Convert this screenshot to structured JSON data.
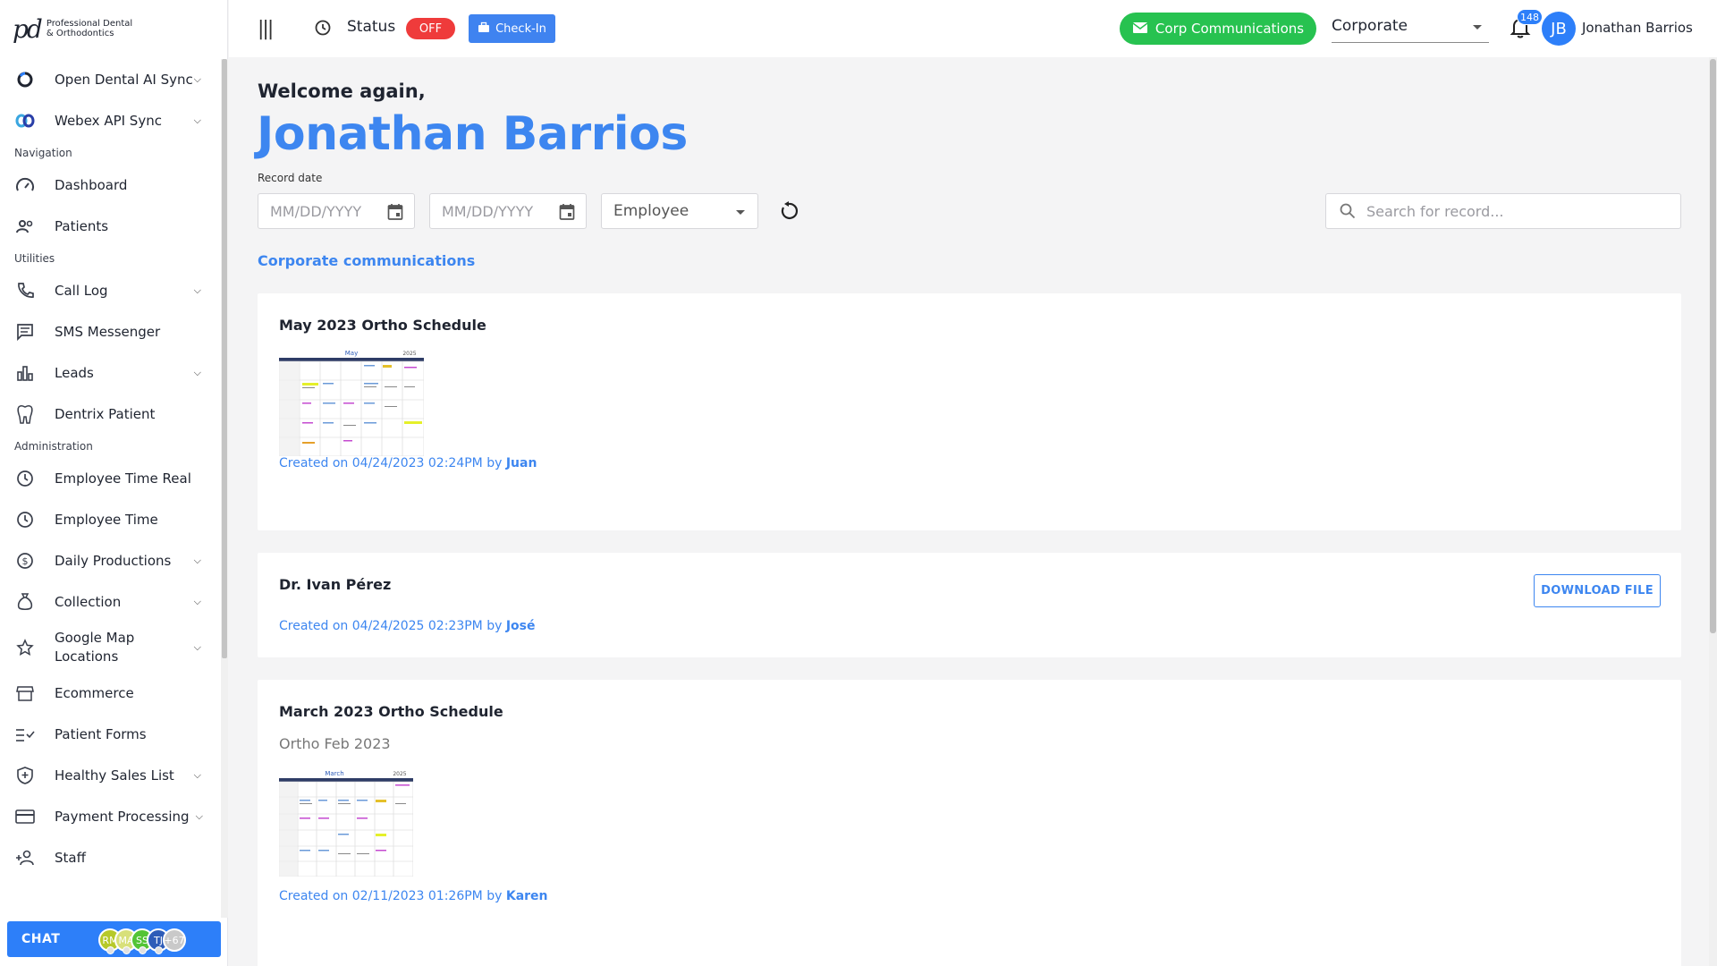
{
  "brand": {
    "name_line1": "Professional Dental",
    "name_line2": "& Orthodontics",
    "mark": "pd"
  },
  "sidebar": {
    "top_items": [
      {
        "label": "Open Dental AI Sync",
        "icon": "circle-icon",
        "expandable": true
      },
      {
        "label": "Webex API Sync",
        "icon": "webex-icon",
        "expandable": true
      }
    ],
    "sections": [
      {
        "title": "Navigation",
        "items": [
          {
            "label": "Dashboard",
            "icon": "gauge-icon",
            "expandable": false
          },
          {
            "label": "Patients",
            "icon": "users-icon",
            "expandable": false
          }
        ]
      },
      {
        "title": "Utilities",
        "items": [
          {
            "label": "Call Log",
            "icon": "phone-icon",
            "expandable": true
          },
          {
            "label": "SMS Messenger",
            "icon": "message-icon",
            "expandable": false
          },
          {
            "label": "Leads",
            "icon": "bar-chart-icon",
            "expandable": true
          },
          {
            "label": "Dentrix Patient",
            "icon": "tooth-icon",
            "expandable": false
          }
        ]
      },
      {
        "title": "Administration",
        "items": [
          {
            "label": "Employee Time Real",
            "icon": "clock-icon",
            "expandable": false
          },
          {
            "label": "Employee Time",
            "icon": "clock-icon",
            "expandable": false
          },
          {
            "label": "Daily Productions",
            "icon": "dollar-icon",
            "expandable": true
          },
          {
            "label": "Collection",
            "icon": "money-bag-icon",
            "expandable": true
          },
          {
            "label": "Google Map Locations",
            "icon": "star-icon",
            "expandable": true
          },
          {
            "label": "Ecommerce",
            "icon": "store-icon",
            "expandable": false
          },
          {
            "label": "Patient Forms",
            "icon": "checklist-icon",
            "expandable": false
          },
          {
            "label": "Healthy Sales List",
            "icon": "shield-icon",
            "expandable": true
          },
          {
            "label": "Payment Processing",
            "icon": "card-icon",
            "expandable": true
          },
          {
            "label": "Staff",
            "icon": "add-person-icon",
            "expandable": false
          }
        ]
      }
    ],
    "chat": {
      "label": "CHAT",
      "avatars": [
        {
          "initials": "RM",
          "color": "#b6c92a"
        },
        {
          "initials": "MA",
          "color": "#d8e07a"
        },
        {
          "initials": "SS",
          "color": "#53c435"
        },
        {
          "initials": "TJ",
          "color": "#2e5cb8"
        },
        {
          "initials": "+67",
          "color": "#c9c9c9"
        }
      ]
    }
  },
  "header": {
    "status_label": "Status",
    "status_value": "OFF",
    "checkin_label": "Check-In",
    "corp_button_label": "Corp Communications",
    "company_select": "Corporate",
    "notifications_count": "148",
    "user_initials": "JB",
    "user_name": "Jonathan Barrios"
  },
  "main": {
    "welcome": "Welcome again,",
    "user_name": "Jonathan Barrios",
    "filters": {
      "record_date_label": "Record date",
      "date_from_placeholder": "MM/DD/YYYY",
      "date_to_placeholder": "MM/DD/YYYY",
      "employee_select": "Employee",
      "search_placeholder": "Search for record..."
    },
    "section_title": "Corporate communications",
    "cards": [
      {
        "title": "May 2023 Ortho Schedule",
        "subtitle": "",
        "thumb_month": "May",
        "thumb_year": "2025",
        "created_prefix": "Created on ",
        "created_date": "04/24/2023 02:24PM",
        "by": " by ",
        "author": "Juan"
      },
      {
        "title": "Dr. Ivan Pérez",
        "subtitle": "",
        "download_label": "DOWNLOAD FILE",
        "created_prefix": "Created on ",
        "created_date": "04/24/2025 02:23PM",
        "by": " by ",
        "author": "José"
      },
      {
        "title": "March 2023 Ortho Schedule",
        "subtitle": "Ortho Feb 2023",
        "thumb_month": "March",
        "thumb_year": "2025",
        "created_prefix": "Created on ",
        "created_date": "02/11/2023 01:26PM",
        "by": " by ",
        "author": "Karen"
      }
    ]
  },
  "colors": {
    "accent": "#3d86f0",
    "status_off": "#ef3b3b",
    "corp_green": "#27c250",
    "chat_blue": "#2d7ff9"
  }
}
